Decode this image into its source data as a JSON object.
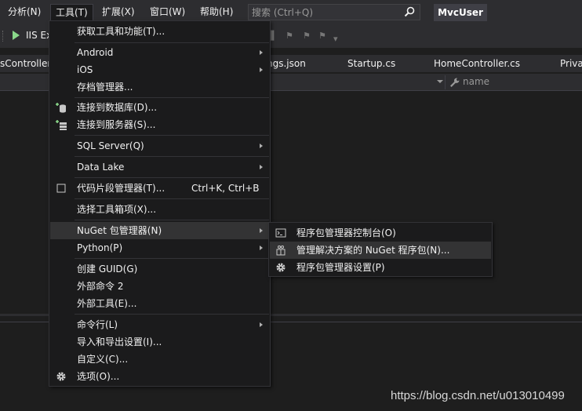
{
  "menubar": {
    "items": [
      {
        "label": "分析(N)"
      },
      {
        "label": "工具(T)"
      },
      {
        "label": "扩展(X)"
      },
      {
        "label": "窗口(W)"
      },
      {
        "label": "帮助(H)"
      }
    ],
    "search_placeholder": "搜索 (Ctrl+Q)",
    "project_name": "MvcUser"
  },
  "toolbar": {
    "run_label": "IIS Ex"
  },
  "tabs": [
    {
      "label": "sController"
    },
    {
      "label": "ngs.json"
    },
    {
      "label": "Startup.cs"
    },
    {
      "label": "HomeController.cs"
    },
    {
      "label": "Priva"
    }
  ],
  "navbar": {
    "member": "name"
  },
  "tools_menu": {
    "items": [
      {
        "label": "获取工具和功能(T)..."
      },
      {
        "label": "Android"
      },
      {
        "label": "iOS"
      },
      {
        "label": "存档管理器..."
      },
      {
        "label": "连接到数据库(D)..."
      },
      {
        "label": "连接到服务器(S)..."
      },
      {
        "label": "SQL Server(Q)"
      },
      {
        "label": "Data Lake"
      },
      {
        "label": "代码片段管理器(T)...",
        "shortcut": "Ctrl+K, Ctrl+B"
      },
      {
        "label": "选择工具箱项(X)..."
      },
      {
        "label": "NuGet 包管理器(N)"
      },
      {
        "label": "Python(P)"
      },
      {
        "label": "创建 GUID(G)"
      },
      {
        "label": "外部命令 2"
      },
      {
        "label": "外部工具(E)..."
      },
      {
        "label": "命令行(L)"
      },
      {
        "label": "导入和导出设置(I)..."
      },
      {
        "label": "自定义(C)..."
      },
      {
        "label": "选项(O)..."
      }
    ]
  },
  "nuget_submenu": {
    "items": [
      {
        "label": "程序包管理器控制台(O)"
      },
      {
        "label": "管理解决方案的 NuGet 程序包(N)..."
      },
      {
        "label": "程序包管理器设置(P)"
      }
    ]
  },
  "watermark": "https://blog.csdn.net/u013010499",
  "colors": {
    "background": "#1e1e1e",
    "chrome": "#2d2d30",
    "menu_bg": "#1b1b1c",
    "highlight": "#333334",
    "run_green": "#8ad88a"
  }
}
